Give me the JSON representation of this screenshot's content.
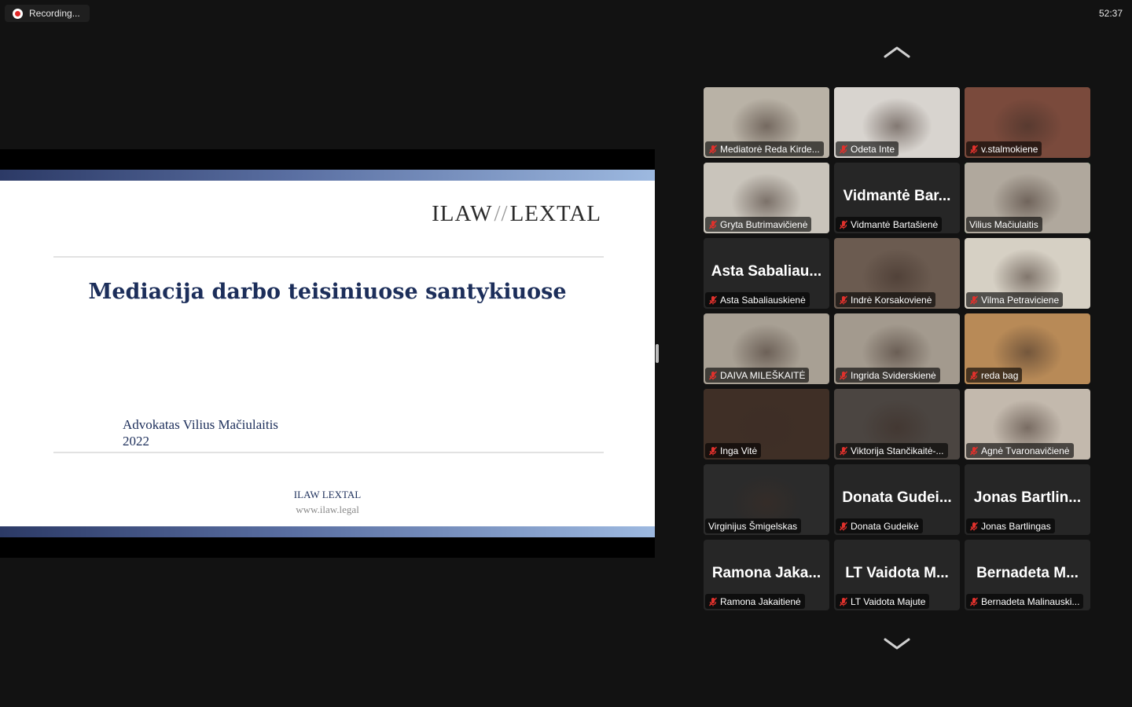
{
  "recording": {
    "label": "Recording...",
    "timer": "52:37"
  },
  "slide": {
    "logo_left": "ILAW",
    "logo_right": "LEXTAL",
    "title": "Mediacija darbo teisiniuose santykiuose",
    "author": "Advokatas Vilius Mačiulaitis",
    "year": "2022",
    "footer_brand": "ILAW LEXTAL",
    "footer_url": "www.ilaw.legal"
  },
  "participants": [
    {
      "name": "Mediatorė Reda Kirde...",
      "muted": true,
      "video": true,
      "bg": "#b9b2a6"
    },
    {
      "name": "Odeta Inte",
      "muted": true,
      "video": true,
      "bg": "#d8d4cf"
    },
    {
      "name": "v.stalmokiene",
      "muted": true,
      "video": true,
      "bg": "#7a4a3c"
    },
    {
      "name": "Gryta Butrimavičienė",
      "muted": true,
      "video": true,
      "bg": "#c9c4bb"
    },
    {
      "name": "Vidmantė Bartašienė",
      "display": "Vidmantė Bar...",
      "muted": true,
      "video": false
    },
    {
      "name": "Vilius Mačiulaitis",
      "muted": false,
      "video": true,
      "active": true,
      "bg": "#b0a89d"
    },
    {
      "name": "Asta Sabaliauskienė",
      "display": "Asta Sabaliau...",
      "muted": true,
      "video": false
    },
    {
      "name": "Indrė Korsakovienė",
      "muted": true,
      "video": true,
      "bg": "#6b5b50"
    },
    {
      "name": "Vilma Petraviciene",
      "muted": true,
      "video": true,
      "bg": "#d6d0c4"
    },
    {
      "name": "DAIVA MILEŠKAITĖ",
      "muted": true,
      "video": true,
      "bg": "#a8a094"
    },
    {
      "name": "Ingrida Sviderskienė",
      "muted": true,
      "video": true,
      "bg": "#a39a8e"
    },
    {
      "name": "reda bag",
      "muted": true,
      "video": true,
      "bg": "#b88a57"
    },
    {
      "name": "Inga Vitė",
      "muted": true,
      "video": true,
      "bg": "#3f2f26"
    },
    {
      "name": "Viktorija Stančikaitė-...",
      "muted": true,
      "video": true,
      "bg": "#4b4541"
    },
    {
      "name": "Agnė Tvaronavičienė",
      "muted": true,
      "video": true,
      "bg": "#c3b9ad"
    },
    {
      "name": "Virginijus Šmigelskas",
      "muted": false,
      "video": true,
      "bg": "#2b2b2b"
    },
    {
      "name": "Donata Gudeikė",
      "display": "Donata Gudei...",
      "muted": true,
      "video": false
    },
    {
      "name": "Jonas Bartlingas",
      "display": "Jonas Bartlin...",
      "muted": true,
      "video": false
    },
    {
      "name": "Ramona Jakaitienė",
      "display": "Ramona Jaka...",
      "muted": true,
      "video": false
    },
    {
      "name": "LT Vaidota Majute",
      "display": "LT Vaidota M...",
      "muted": true,
      "video": false
    },
    {
      "name": "Bernadeta Malinauski...",
      "display": "Bernadeta M...",
      "muted": true,
      "video": false
    }
  ],
  "icons": {
    "recording": "record-dot-icon",
    "mic_muted": "mic-muted-icon",
    "scroll_up": "chevron-up-icon",
    "scroll_down": "chevron-down-icon"
  },
  "colors": {
    "active_speaker": "#2bd25c",
    "mute_red": "#e0312c",
    "slide_title": "#1c2e5a"
  }
}
